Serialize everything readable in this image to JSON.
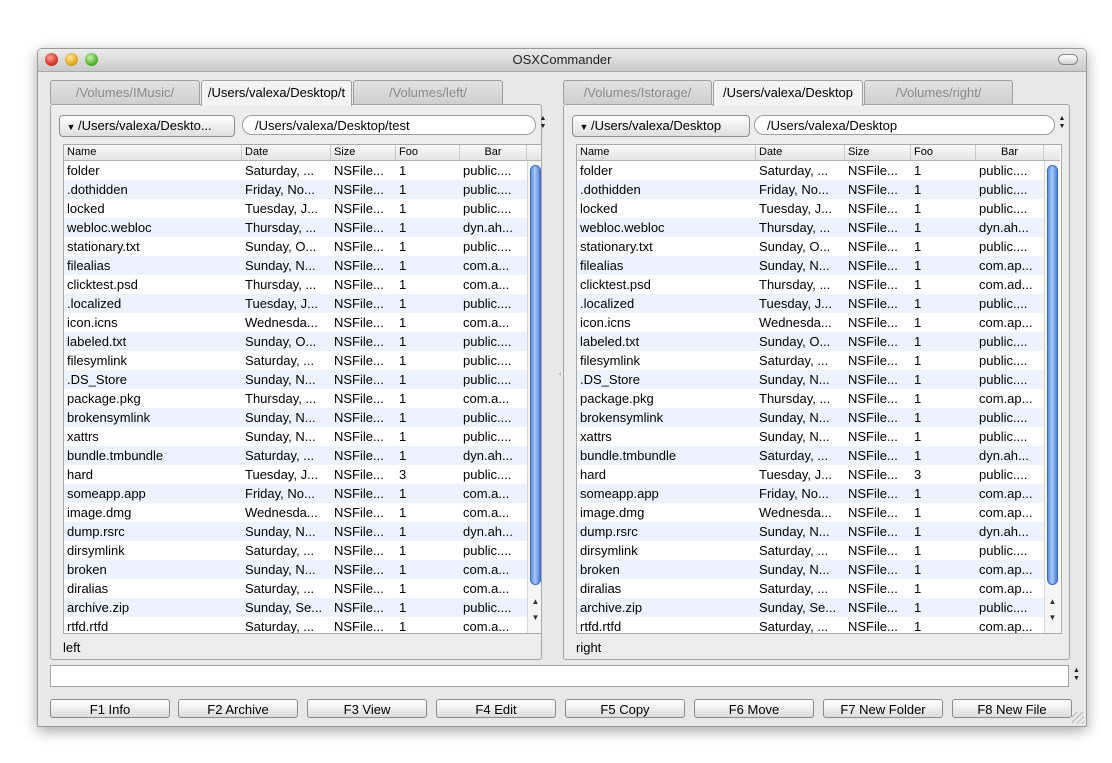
{
  "window": {
    "title": "OSXCommander"
  },
  "left": {
    "tabs": [
      "/Volumes/IMusic/",
      "/Users/valexa/Desktop/t",
      "/Volumes/left/"
    ],
    "active_tab": 1,
    "dropdown": "/Users/valexa/Deskto...",
    "path": "/Users/valexa/Desktop/test",
    "label": "left"
  },
  "right": {
    "tabs": [
      "/Volumes/Istorage/",
      "/Users/valexa/Desktop",
      "/Volumes/right/"
    ],
    "active_tab": 1,
    "dropdown": "/Users/valexa/Desktop",
    "path": "/Users/valexa/Desktop",
    "label": "right"
  },
  "columns": [
    "Name",
    "Date",
    "Size",
    "Foo",
    "Bar"
  ],
  "left_rows": [
    [
      "folder",
      "Saturday, ...",
      "NSFile...",
      "1",
      "public...."
    ],
    [
      ".dothidden",
      "Friday, No...",
      "NSFile...",
      "1",
      "public...."
    ],
    [
      "locked",
      "Tuesday, J...",
      "NSFile...",
      "1",
      "public...."
    ],
    [
      "webloc.webloc",
      "Thursday, ...",
      "NSFile...",
      "1",
      "dyn.ah..."
    ],
    [
      "stationary.txt",
      "Sunday, O...",
      "NSFile...",
      "1",
      "public...."
    ],
    [
      "filealias",
      "Sunday, N...",
      "NSFile...",
      "1",
      "com.a..."
    ],
    [
      "clicktest.psd",
      "Thursday, ...",
      "NSFile...",
      "1",
      "com.a..."
    ],
    [
      ".localized",
      "Tuesday, J...",
      "NSFile...",
      "1",
      "public...."
    ],
    [
      "icon.icns",
      "Wednesda...",
      "NSFile...",
      "1",
      "com.a..."
    ],
    [
      "labeled.txt",
      "Sunday, O...",
      "NSFile...",
      "1",
      "public...."
    ],
    [
      "filesymlink",
      "Saturday, ...",
      "NSFile...",
      "1",
      "public...."
    ],
    [
      ".DS_Store",
      "Sunday, N...",
      "NSFile...",
      "1",
      "public...."
    ],
    [
      "package.pkg",
      "Thursday, ...",
      "NSFile...",
      "1",
      "com.a..."
    ],
    [
      "brokensymlink",
      "Sunday, N...",
      "NSFile...",
      "1",
      "public...."
    ],
    [
      "xattrs",
      "Sunday, N...",
      "NSFile...",
      "1",
      "public...."
    ],
    [
      "bundle.tmbundle",
      "Saturday, ...",
      "NSFile...",
      "1",
      "dyn.ah..."
    ],
    [
      "hard",
      "Tuesday, J...",
      "NSFile...",
      "3",
      "public...."
    ],
    [
      "someapp.app",
      "Friday, No...",
      "NSFile...",
      "1",
      "com.a..."
    ],
    [
      "image.dmg",
      "Wednesda...",
      "NSFile...",
      "1",
      "com.a..."
    ],
    [
      "dump.rsrc",
      "Sunday, N...",
      "NSFile...",
      "1",
      "dyn.ah..."
    ],
    [
      "dirsymlink",
      "Saturday, ...",
      "NSFile...",
      "1",
      "public...."
    ],
    [
      "broken",
      "Sunday, N...",
      "NSFile...",
      "1",
      "com.a..."
    ],
    [
      "diralias",
      "Saturday, ...",
      "NSFile...",
      "1",
      "com.a..."
    ],
    [
      "archive.zip",
      "Sunday, Se...",
      "NSFile...",
      "1",
      "public...."
    ],
    [
      "rtfd.rtfd",
      "Saturday, ...",
      "NSFile...",
      "1",
      "com.a..."
    ]
  ],
  "right_rows": [
    [
      "folder",
      "Saturday, ...",
      "NSFile...",
      "1",
      "public...."
    ],
    [
      ".dothidden",
      "Friday, No...",
      "NSFile...",
      "1",
      "public...."
    ],
    [
      "locked",
      "Tuesday, J...",
      "NSFile...",
      "1",
      "public...."
    ],
    [
      "webloc.webloc",
      "Thursday, ...",
      "NSFile...",
      "1",
      "dyn.ah..."
    ],
    [
      "stationary.txt",
      "Sunday, O...",
      "NSFile...",
      "1",
      "public...."
    ],
    [
      "filealias",
      "Sunday, N...",
      "NSFile...",
      "1",
      "com.ap..."
    ],
    [
      "clicktest.psd",
      "Thursday, ...",
      "NSFile...",
      "1",
      "com.ad..."
    ],
    [
      ".localized",
      "Tuesday, J...",
      "NSFile...",
      "1",
      "public...."
    ],
    [
      "icon.icns",
      "Wednesda...",
      "NSFile...",
      "1",
      "com.ap..."
    ],
    [
      "labeled.txt",
      "Sunday, O...",
      "NSFile...",
      "1",
      "public...."
    ],
    [
      "filesymlink",
      "Saturday, ...",
      "NSFile...",
      "1",
      "public...."
    ],
    [
      ".DS_Store",
      "Sunday, N...",
      "NSFile...",
      "1",
      "public...."
    ],
    [
      "package.pkg",
      "Thursday, ...",
      "NSFile...",
      "1",
      "com.ap..."
    ],
    [
      "brokensymlink",
      "Sunday, N...",
      "NSFile...",
      "1",
      "public...."
    ],
    [
      "xattrs",
      "Sunday, N...",
      "NSFile...",
      "1",
      "public...."
    ],
    [
      "bundle.tmbundle",
      "Saturday, ...",
      "NSFile...",
      "1",
      "dyn.ah..."
    ],
    [
      "hard",
      "Tuesday, J...",
      "NSFile...",
      "3",
      "public...."
    ],
    [
      "someapp.app",
      "Friday, No...",
      "NSFile...",
      "1",
      "com.ap..."
    ],
    [
      "image.dmg",
      "Wednesda...",
      "NSFile...",
      "1",
      "com.ap..."
    ],
    [
      "dump.rsrc",
      "Sunday, N...",
      "NSFile...",
      "1",
      "dyn.ah..."
    ],
    [
      "dirsymlink",
      "Saturday, ...",
      "NSFile...",
      "1",
      "public...."
    ],
    [
      "broken",
      "Sunday, N...",
      "NSFile...",
      "1",
      "com.ap..."
    ],
    [
      "diralias",
      "Saturday, ...",
      "NSFile...",
      "1",
      "com.ap..."
    ],
    [
      "archive.zip",
      "Sunday, Se...",
      "NSFile...",
      "1",
      "public...."
    ],
    [
      "rtfd.rtfd",
      "Saturday, ...",
      "NSFile...",
      "1",
      "com.ap..."
    ]
  ],
  "command": {
    "value": ""
  },
  "function_keys": [
    "F1 Info",
    "F2 Archive",
    "F3 View",
    "F4 Edit",
    "F5 Copy",
    "F6 Move",
    "F7 New Folder",
    "F8 New File"
  ]
}
